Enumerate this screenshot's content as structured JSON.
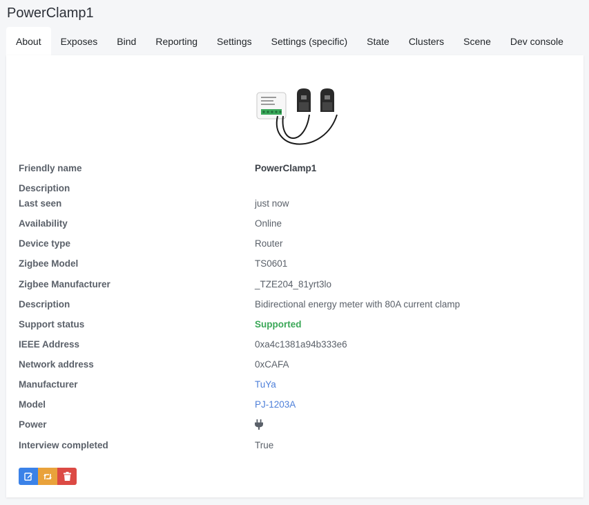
{
  "device": {
    "title": "PowerClamp1"
  },
  "tabs": [
    "About",
    "Exposes",
    "Bind",
    "Reporting",
    "Settings",
    "Settings (specific)",
    "State",
    "Clusters",
    "Scene",
    "Dev console"
  ],
  "props": {
    "friendly_name": {
      "label": "Friendly name",
      "value": "PowerClamp1"
    },
    "description": {
      "label": "Description",
      "value": ""
    },
    "last_seen": {
      "label": "Last seen",
      "value": "just now"
    },
    "availability": {
      "label": "Availability",
      "value": "Online"
    },
    "device_type": {
      "label": "Device type",
      "value": "Router"
    },
    "zigbee_model": {
      "label": "Zigbee Model",
      "value": "TS0601"
    },
    "zigbee_manufacturer": {
      "label": "Zigbee Manufacturer",
      "value": "_TZE204_81yrt3lo"
    },
    "description2": {
      "label": "Description",
      "value": "Bidirectional energy meter with 80A current clamp"
    },
    "support_status": {
      "label": "Support status",
      "value": "Supported"
    },
    "ieee_address": {
      "label": "IEEE Address",
      "value": "0xa4c1381a94b333e6"
    },
    "network_address": {
      "label": "Network address",
      "value": "0xCAFA"
    },
    "manufacturer": {
      "label": "Manufacturer",
      "value": "TuYa"
    },
    "model": {
      "label": "Model",
      "value": "PJ-1203A"
    },
    "power": {
      "label": "Power",
      "icon": "plug-icon"
    },
    "interview_completed": {
      "label": "Interview completed",
      "value": "True"
    }
  },
  "colors": {
    "supported": "#3aa757",
    "link": "#4d7fd9",
    "edit": "#3b82e8",
    "rename": "#e9a23b",
    "remove": "#dc4a44"
  },
  "actions": {
    "edit_icon": "edit-icon",
    "rename_icon": "retweet-icon",
    "remove_icon": "trash-icon"
  }
}
